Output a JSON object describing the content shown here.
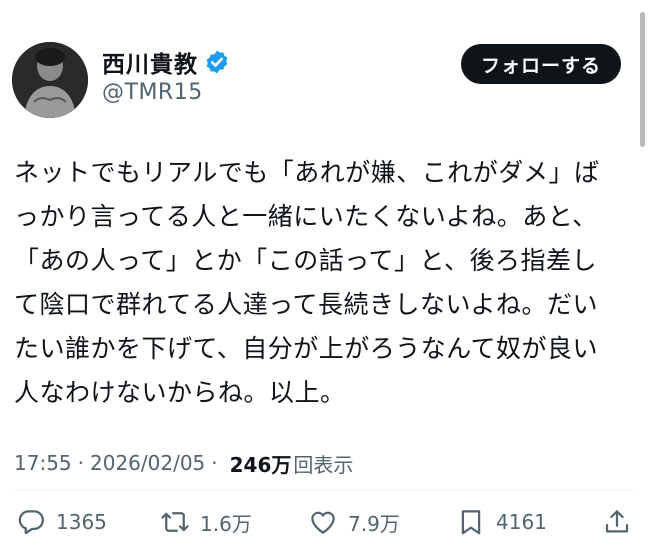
{
  "profile": {
    "display_name": "西川貴教",
    "handle": "@TMR15"
  },
  "follow_button": {
    "label": "フォローする"
  },
  "tweet": {
    "lines": [
      "ネットでもリアルでも「あれが嫌、これがダメ」ば",
      "っかり言ってる人と一緒にいたくないよね。あと、",
      "「あの人って」とか「この話って」と、後ろ指差し",
      "て陰口で群れてる人達って長続きしないよね。だい",
      "たい誰かを下げて、自分が上がろうなんて奴が良い",
      "人なわけないからね。以上。"
    ]
  },
  "meta": {
    "time": "17:55",
    "separator": "·",
    "date": "2026/02/05",
    "views_count": "246万",
    "views_label": "回表示"
  },
  "actions": {
    "reply": {
      "icon": "reply-icon",
      "count": "1365"
    },
    "repost": {
      "icon": "repost-icon",
      "count": "1.6万"
    },
    "like": {
      "icon": "heart-icon",
      "count": "7.9万"
    },
    "bookmark": {
      "icon": "bookmark-icon",
      "count": "4161"
    },
    "share": {
      "icon": "share-icon"
    }
  },
  "colors": {
    "text": "#0f1419",
    "secondary": "#536471",
    "verified": "#1d9bf0",
    "button_bg": "#0f1419",
    "button_text": "#ffffff"
  }
}
